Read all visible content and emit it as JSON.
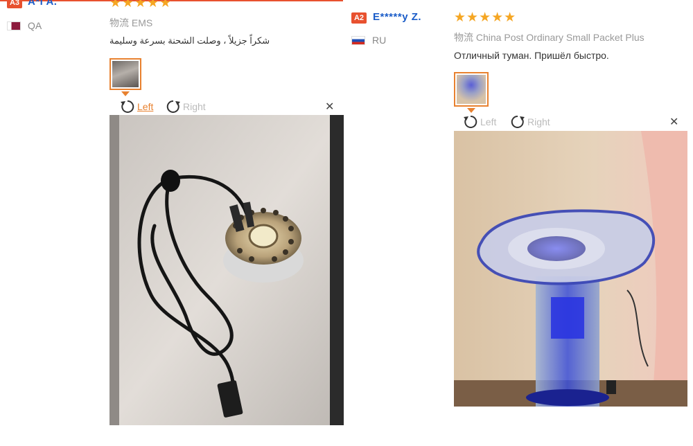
{
  "reviews": [
    {
      "badge": "A3",
      "username": "A*l A.",
      "country": "QA",
      "stars": "★★★★★",
      "shipping": "物流 EMS",
      "text": "شكراً جزيلاً ، وصلت الشحنة بسرعة وسليمة",
      "rotate_left": "Left",
      "rotate_right": "Right",
      "close": "✕"
    },
    {
      "badge": "A2",
      "username": "E*****y Z.",
      "country": "RU",
      "stars": "★★★★★",
      "shipping": "物流 China Post Ordinary Small Packet Plus",
      "text": "Отличный туман. Пришёл быстро.",
      "rotate_left": "Left",
      "rotate_right": "Right",
      "close": "✕"
    }
  ],
  "colors": {
    "badge_a3": "#e8512f",
    "badge_a2": "#e8512f",
    "username": "#1a5cc8",
    "stars": "#f5a623",
    "accent": "#e8812f"
  }
}
